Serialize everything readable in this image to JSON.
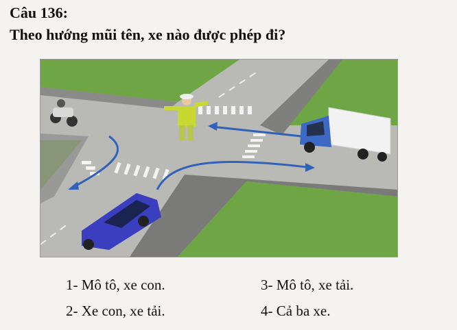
{
  "question": {
    "number": "Câu 136:",
    "text": "Theo hướng mũi tên, xe nào được phép đi?"
  },
  "illustration": {
    "description_icons": [
      "motorcycle-icon",
      "car-icon",
      "truck-icon",
      "traffic-police-icon"
    ],
    "colors": {
      "grass": "#6ea545",
      "road": "#b9bab6",
      "paving": "#7f7f7d",
      "arrow": "#2f62b8",
      "car": "#3a3fc0",
      "truck_cab": "#3d68c4",
      "truck_box": "#f2f2f2"
    }
  },
  "options": [
    {
      "label": "1- Mô tô, xe con."
    },
    {
      "label": "2- Xe con, xe tải."
    },
    {
      "label": "3- Mô tô, xe tải."
    },
    {
      "label": "4- Cả ba xe."
    }
  ]
}
